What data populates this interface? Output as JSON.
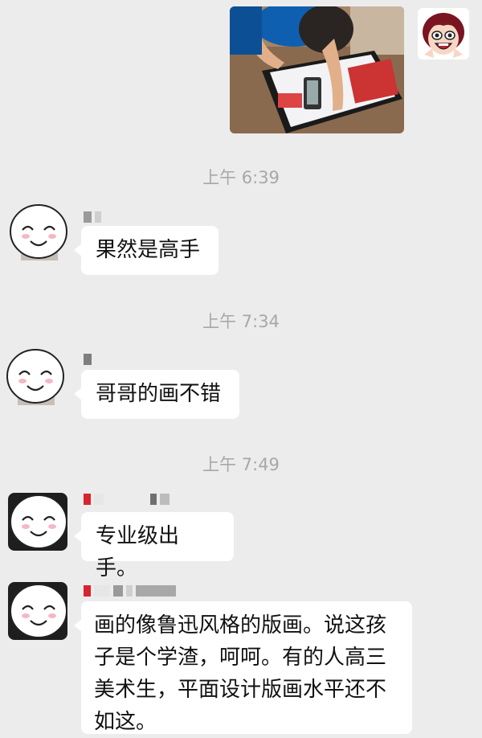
{
  "chat": {
    "times": [
      "上午 6:39",
      "上午 7:34",
      "上午 7:49"
    ],
    "messages": [
      {
        "text": "果然是高手"
      },
      {
        "text": "哥哥的画不错"
      },
      {
        "text": "专业级出手。"
      },
      {
        "text": "画的像鲁迅风格的版画。说这孩子是个学渣，呵呵。有的人高三美术生，平面设计版画水平还不如这。"
      }
    ]
  },
  "colors": {
    "background": "#ececec",
    "bubble": "#ffffff",
    "timestamp": "#a8a8a8",
    "text": "#111111"
  },
  "icons": {
    "sender_avatar": "smiley-face-avatar",
    "my_avatar": "cartoon-girl-avatar"
  }
}
